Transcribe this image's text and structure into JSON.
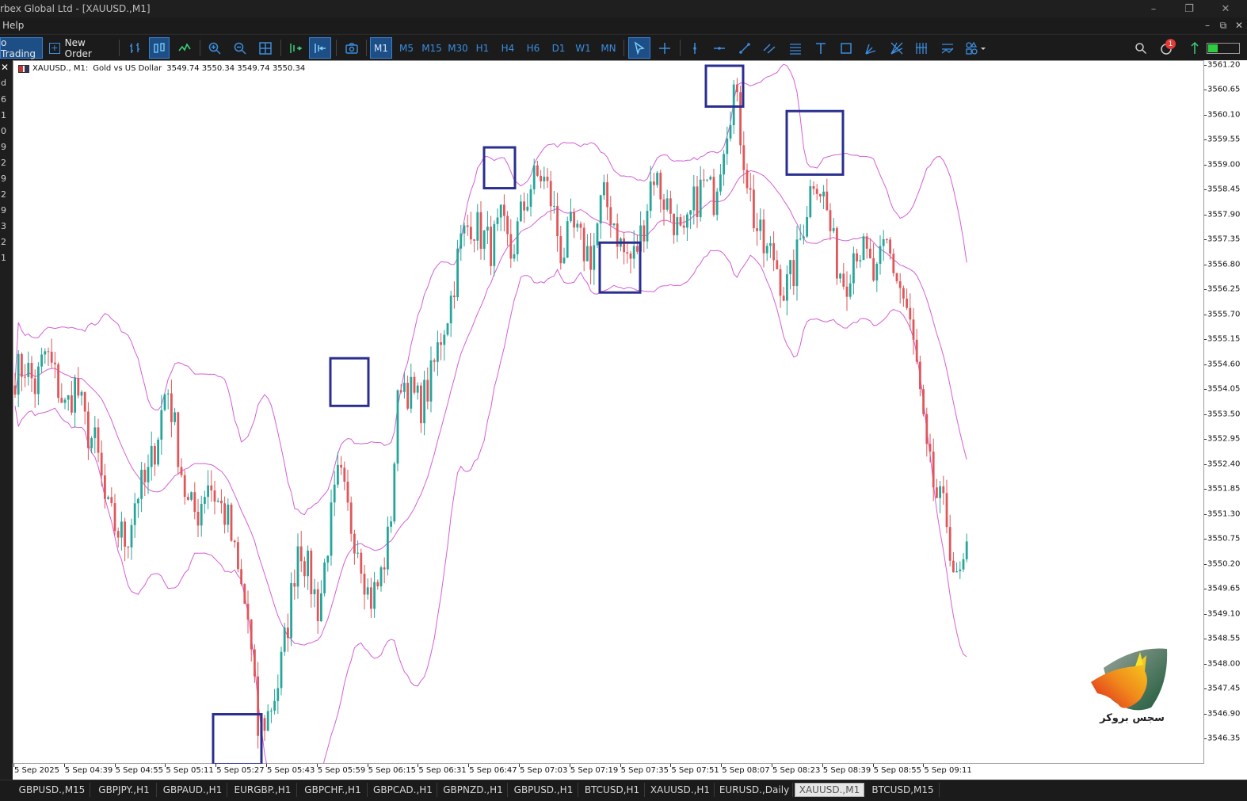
{
  "window": {
    "title": "rbex Global Ltd - [XAUUSD.,M1]",
    "controls": [
      "–",
      "❐",
      "✕"
    ]
  },
  "menubar": {
    "items": [
      "Help"
    ],
    "mdi_controls": [
      "–",
      "⧉",
      "✕"
    ]
  },
  "toolbar": {
    "algo_trading_label": "o Trading",
    "new_order_label": "New Order",
    "timeframes": [
      "M1",
      "M5",
      "M15",
      "M30",
      "H1",
      "H4",
      "H6",
      "D1",
      "W1",
      "MN"
    ],
    "active_timeframe": "M1",
    "notification_count": "1"
  },
  "left_strip": [
    "d",
    "6",
    "1",
    "0",
    "9",
    "2",
    "9",
    "2",
    "9",
    "3",
    "2",
    "1"
  ],
  "chart": {
    "symbol": "XAUUSD., M1:",
    "description": "Gold vs US Dollar",
    "ohlc": "3549.74 3550.34 3549.74 3550.34",
    "background": "#ffffff",
    "bull_color": "#26a69a",
    "bear_color": "#e0565a",
    "band_color": "#d35fd3",
    "box_color": "#2a2f8f"
  },
  "chart_data": {
    "type": "candlestick",
    "symbol": "XAUUSD.",
    "timeframe": "M1",
    "ylim": [
      3545.9,
      3561.3
    ],
    "yticks": [
      "3561.20",
      "3560.65",
      "3560.10",
      "3559.55",
      "3559.00",
      "3558.45",
      "3557.90",
      "3557.35",
      "3556.80",
      "3556.25",
      "3555.70",
      "3555.15",
      "3554.60",
      "3554.05",
      "3553.50",
      "3552.95",
      "3552.40",
      "3551.85",
      "3551.30",
      "3550.75",
      "3550.20",
      "3549.65",
      "3549.10",
      "3548.55",
      "3548.00",
      "3547.45",
      "3546.90",
      "3546.35"
    ],
    "xticks": [
      "5 Sep 2025",
      "5 Sep 04:39",
      "5 Sep 04:55",
      "5 Sep 05:11",
      "5 Sep 05:27",
      "5 Sep 05:43",
      "5 Sep 05:59",
      "5 Sep 06:15",
      "5 Sep 06:31",
      "5 Sep 06:47",
      "5 Sep 07:03",
      "5 Sep 07:19",
      "5 Sep 07:35",
      "5 Sep 07:51",
      "5 Sep 08:07",
      "5 Sep 08:23",
      "5 Sep 08:39",
      "5 Sep 08:55",
      "5 Sep 09:11"
    ],
    "close_path": [
      3554.4,
      3554.6,
      3554.1,
      3554.9,
      3554.3,
      3553.6,
      3554.2,
      3553.2,
      3552.8,
      3551.4,
      3551.0,
      3550.7,
      3551.8,
      3552.0,
      3553.0,
      3554.2,
      3552.9,
      3551.5,
      3551.3,
      3552.1,
      3551.6,
      3551.2,
      3550.0,
      3549.0,
      3546.5,
      3546.9,
      3547.6,
      3549.0,
      3550.8,
      3550.0,
      3549.2,
      3550.9,
      3552.2,
      3551.2,
      3550.6,
      3549.4,
      3549.8,
      3550.9,
      3554.4,
      3554.0,
      3553.7,
      3554.2,
      3555.2,
      3556.0,
      3557.3,
      3557.8,
      3557.5,
      3557.2,
      3557.7,
      3557.0,
      3557.9,
      3558.6,
      3558.8,
      3558.2,
      3557.0,
      3557.6,
      3557.2,
      3557.0,
      3558.3,
      3557.9,
      3557.1,
      3556.9,
      3557.6,
      3558.9,
      3558.3,
      3557.9,
      3557.2,
      3558.1,
      3558.6,
      3558.3,
      3559.6,
      3560.7,
      3559.2,
      3557.8,
      3557.1,
      3557.0,
      3556.2,
      3556.7,
      3557.9,
      3558.9,
      3558.2,
      3557.0,
      3556.4,
      3557.3,
      3557.0,
      3556.4,
      3557.3,
      3556.6,
      3555.9,
      3554.7,
      3552.6,
      3551.7,
      3551.2,
      3549.7,
      3550.3
    ]
  },
  "annotations": [
    {
      "label": "box-low-05-27",
      "time": "5 Sep 05:27",
      "price_top": 3546.9,
      "price_bottom": 3545.8
    },
    {
      "label": "box-05-59",
      "time": "5 Sep 05:59",
      "price_top": 3554.75,
      "price_bottom": 3553.7
    },
    {
      "label": "box-06-47",
      "time": "5 Sep 06:47",
      "price_top": 3559.4,
      "price_bottom": 3558.5
    },
    {
      "label": "box-07-25",
      "time": "5 Sep 07:25",
      "price_top": 3557.3,
      "price_bottom": 3556.2
    },
    {
      "label": "box-high-08-07",
      "time": "5 Sep 08:07",
      "price_top": 3561.2,
      "price_bottom": 3560.3
    },
    {
      "label": "box-08-23",
      "time": "5 Sep 08:23",
      "price_top": 3560.2,
      "price_bottom": 3558.8
    }
  ],
  "watermark": {
    "text": "سجس بروکر"
  },
  "tabs": [
    {
      "label": "GBPUSD.,M15",
      "active": false
    },
    {
      "label": "GBPJPY.,H1",
      "active": false
    },
    {
      "label": "GBPAUD.,H1",
      "active": false
    },
    {
      "label": "EURGBP.,H1",
      "active": false
    },
    {
      "label": "GBPCHF.,H1",
      "active": false
    },
    {
      "label": "GBPCAD.,H1",
      "active": false
    },
    {
      "label": "GBPNZD.,H1",
      "active": false
    },
    {
      "label": "GBPUSD.,H1",
      "active": false
    },
    {
      "label": "BTCUSD,H1",
      "active": false
    },
    {
      "label": "XAUUSD.,H1",
      "active": false
    },
    {
      "label": "EURUSD.,Daily",
      "active": false
    },
    {
      "label": "XAUUSD.,M1",
      "active": true
    },
    {
      "label": "BTCUSD,M15",
      "active": false
    }
  ]
}
